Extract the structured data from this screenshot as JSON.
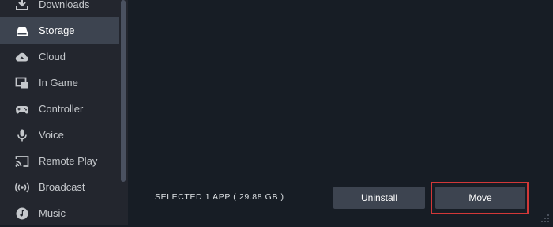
{
  "sidebar": {
    "items": [
      {
        "label": "Downloads",
        "icon": "download-icon",
        "active": false
      },
      {
        "label": "Storage",
        "icon": "storage-drive-icon",
        "active": true
      },
      {
        "label": "Cloud",
        "icon": "cloud-icon",
        "active": false
      },
      {
        "label": "In Game",
        "icon": "in-game-overlay-icon",
        "active": false
      },
      {
        "label": "Controller",
        "icon": "gamepad-icon",
        "active": false
      },
      {
        "label": "Voice",
        "icon": "microphone-icon",
        "active": false
      },
      {
        "label": "Remote Play",
        "icon": "cast-screen-icon",
        "active": false
      },
      {
        "label": "Broadcast",
        "icon": "broadcast-icon",
        "active": false
      },
      {
        "label": "Music",
        "icon": "music-icon",
        "active": false
      }
    ]
  },
  "footer": {
    "selected_text": "SELECTED 1 APP ( 29.88 GB )",
    "uninstall_label": "Uninstall",
    "move_label": "Move"
  },
  "colors": {
    "background": "#171d25",
    "sidebar": "#23262e",
    "active_item": "#3d4450",
    "button": "#3d4450",
    "highlight": "#d23838"
  }
}
